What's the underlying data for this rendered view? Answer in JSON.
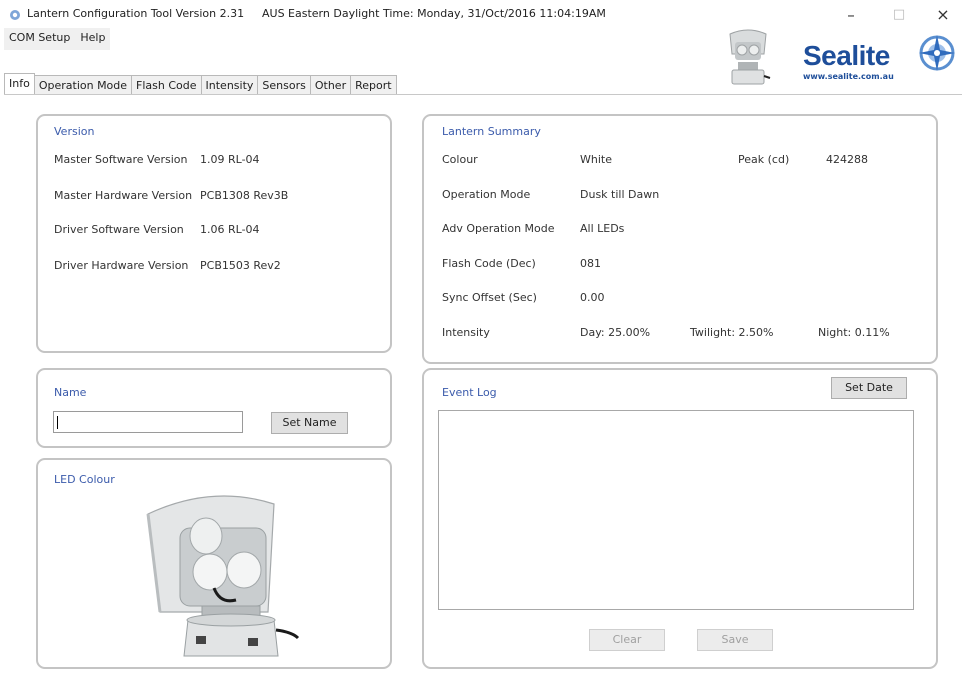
{
  "window": {
    "title": "Lantern Configuration Tool Version 2.31",
    "clock": "AUS Eastern Daylight Time: Monday, 31/Oct/2016 11:04:19AM",
    "minimize_glyph": "–",
    "maximize_glyph": "□",
    "close_glyph": "×"
  },
  "menu": [
    {
      "label": "COM Setup"
    },
    {
      "label": "Help"
    }
  ],
  "tabs": [
    {
      "label": "Info",
      "active": true
    },
    {
      "label": "Operation Mode"
    },
    {
      "label": "Flash Code"
    },
    {
      "label": "Intensity"
    },
    {
      "label": "Sensors"
    },
    {
      "label": "Other"
    },
    {
      "label": "Report"
    }
  ],
  "logo": {
    "name": "Sealite",
    "url": "www.sealite.com.au",
    "brand_color": "#1e4e9a"
  },
  "version": {
    "title": "Version",
    "rows": [
      {
        "label": "Master Software Version",
        "value": "1.09 RL-04"
      },
      {
        "label": "Master Hardware Version",
        "value": "PCB1308 Rev3B"
      },
      {
        "label": "Driver Software Version",
        "value": "1.06 RL-04"
      },
      {
        "label": "Driver Hardware Version",
        "value": "PCB1503 Rev2"
      }
    ]
  },
  "summary": {
    "title": "Lantern Summary",
    "colour_label": "Colour",
    "colour_value": "White",
    "peak_label": "Peak (cd)",
    "peak_value": "424288",
    "op_mode_label": "Operation Mode",
    "op_mode_value": "Dusk till Dawn",
    "adv_op_label": "Adv Operation Mode",
    "adv_op_value": "All LEDs",
    "flash_label": "Flash Code (Dec)",
    "flash_value": "081",
    "sync_label": "Sync Offset (Sec)",
    "sync_value": "0.00",
    "intensity_label": "Intensity",
    "day": "Day: 25.00%",
    "twilight": "Twilight: 2.50%",
    "night": "Night: 0.11%"
  },
  "name_panel": {
    "title": "Name",
    "input_value": "",
    "set_name_label": "Set Name"
  },
  "event_log": {
    "title": "Event Log",
    "set_date_label": "Set Date",
    "clear_label": "Clear",
    "save_label": "Save"
  },
  "led_colour": {
    "title": "LED Colour"
  }
}
